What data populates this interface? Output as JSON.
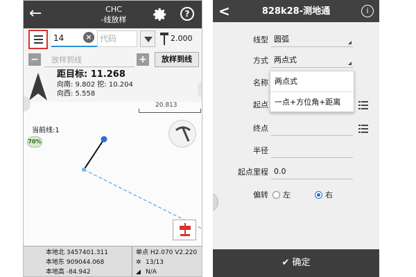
{
  "left_screen": {
    "header": {
      "back_icon": "←",
      "title_line1": "CHC",
      "title_line2": "-线放样",
      "settings_icon": "gear-icon",
      "help_label": "?"
    },
    "toolbar": {
      "menu_icon": "menu-icon",
      "line_number": "14",
      "code_placeholder": "代码",
      "antenna_height": "2.000"
    },
    "stake_row": {
      "minus_label": "−",
      "placeholder": "放样到线",
      "plus_label": "+",
      "button_label": "放样到线"
    },
    "info": {
      "distance_label": "距目标: 11.268",
      "north_fill": "向南: 9.802  挖: 10.204",
      "west": "向西: 5.558"
    },
    "map": {
      "scale_value": "20.813",
      "current_line_label": "当前线:1",
      "percent_badge": "70%"
    },
    "status_bar": {
      "local_north": "本地北 3457401.311",
      "local_east": "本地东 909044.068",
      "local_height": "本地高 -84.942",
      "solution": "单点 H2.070 V2.220",
      "satellites": "13/13",
      "age": "N/A"
    },
    "colors": {
      "header_bg": "#3d3d3d",
      "accent_red": "#d8322d",
      "line_blue": "#2a8fd6"
    }
  },
  "right_screen": {
    "header": {
      "back_icon": "<",
      "title": "828k28-测地通",
      "info_label": "i"
    },
    "form": {
      "line_type": {
        "label": "线型",
        "value": "圆弧"
      },
      "method": {
        "label": "方式",
        "value": "两点式"
      },
      "name": {
        "label": "名称",
        "value": ""
      },
      "start_point": {
        "label": "起点",
        "value": ""
      },
      "end_point": {
        "label": "终点",
        "value": ""
      },
      "radius": {
        "label": "半径",
        "value": ""
      },
      "start_mileage": {
        "label": "起点里程",
        "value": "0.0"
      },
      "deflection": {
        "label": "偏转",
        "option_left": "左",
        "option_right": "右",
        "selected": "右"
      }
    },
    "dropdown_options": [
      "两点式",
      "一点+方位角+距离"
    ],
    "confirm_label": "确定",
    "colors": {
      "header_bg": "#414141",
      "radio_blue": "#2a6fc9"
    }
  }
}
